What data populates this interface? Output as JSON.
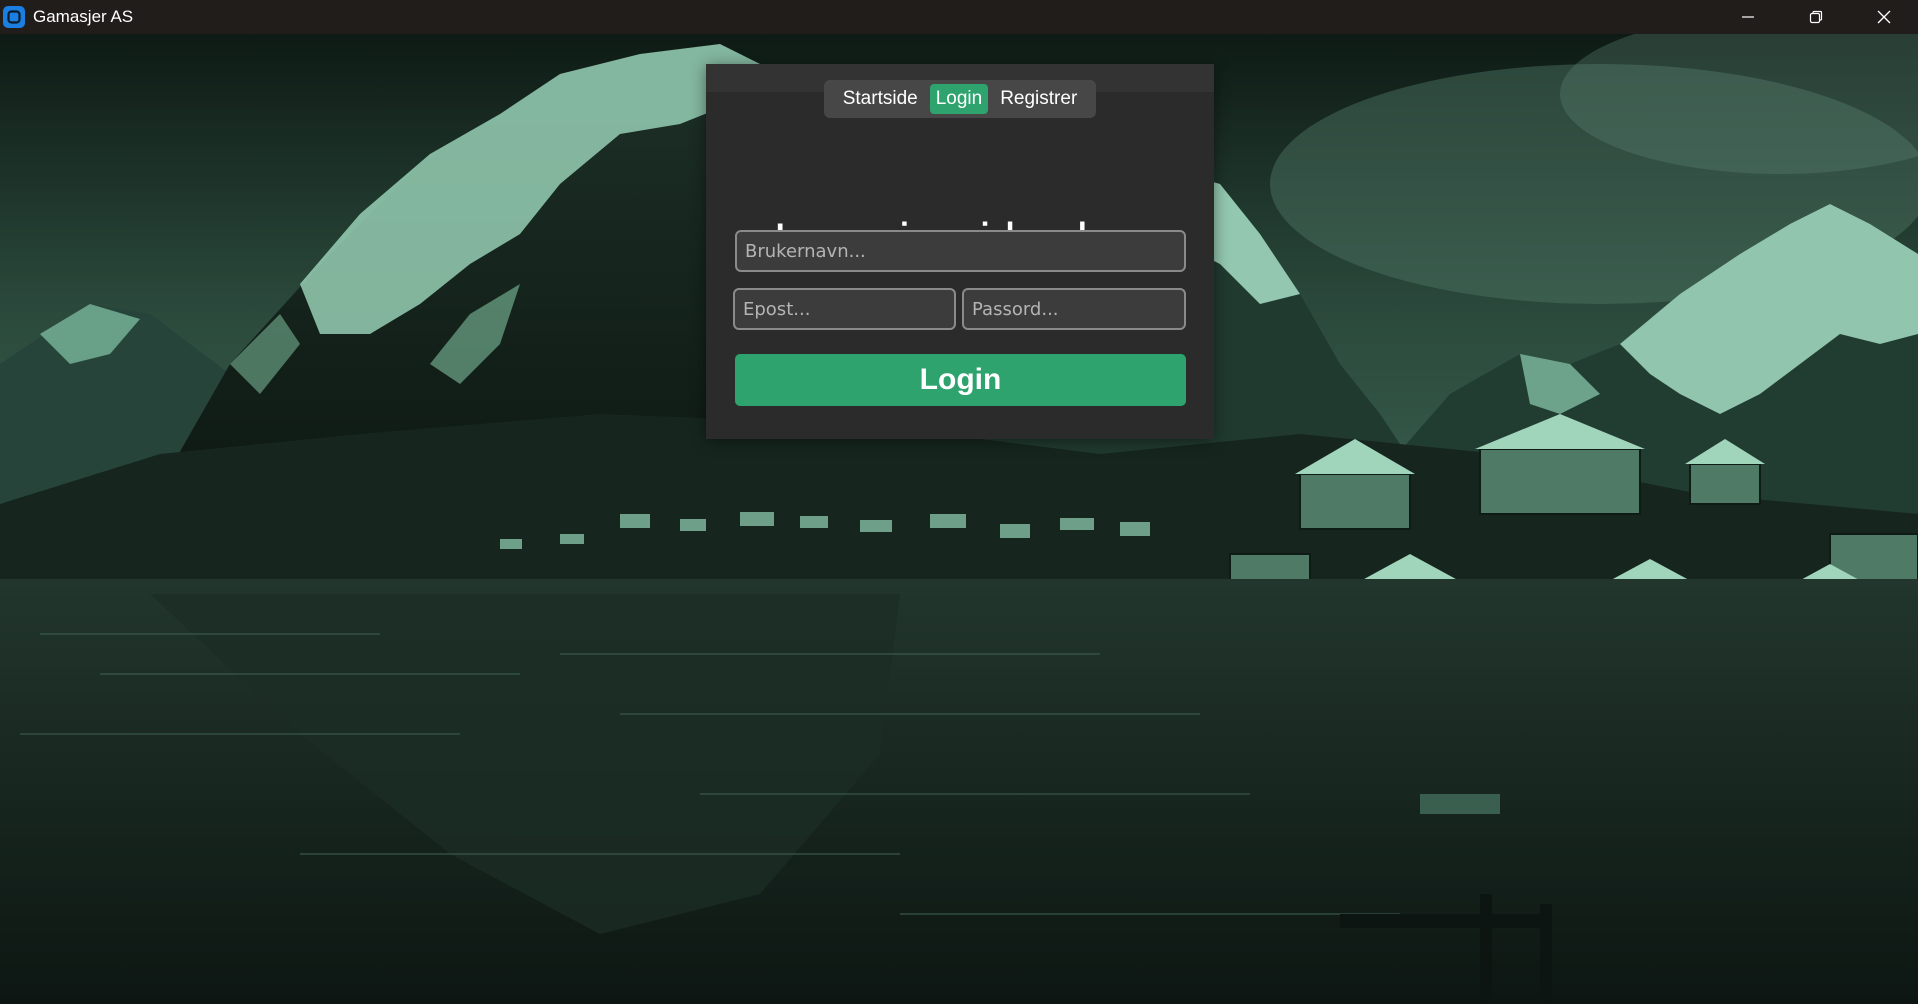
{
  "window": {
    "title": "Gamasjer AS",
    "icon": "app-logo-icon",
    "controls": [
      "minimize-icon",
      "restore-icon",
      "close-icon"
    ]
  },
  "nav": {
    "items": [
      {
        "label": "Startside",
        "active": false
      },
      {
        "label": "Login",
        "active": true
      },
      {
        "label": "Registrer",
        "active": false
      }
    ]
  },
  "form": {
    "title": "Logg inn i bruker",
    "username_placeholder": "Brukernavn...",
    "email_placeholder": "Epost...",
    "password_placeholder": "Passord...",
    "submit_label": "Login"
  },
  "colors": {
    "accent": "#2ea36e",
    "card": "#2b2b2b",
    "nav": "#474747",
    "titlebar": "#201d1b",
    "background_tint": "#6fc7a1"
  }
}
